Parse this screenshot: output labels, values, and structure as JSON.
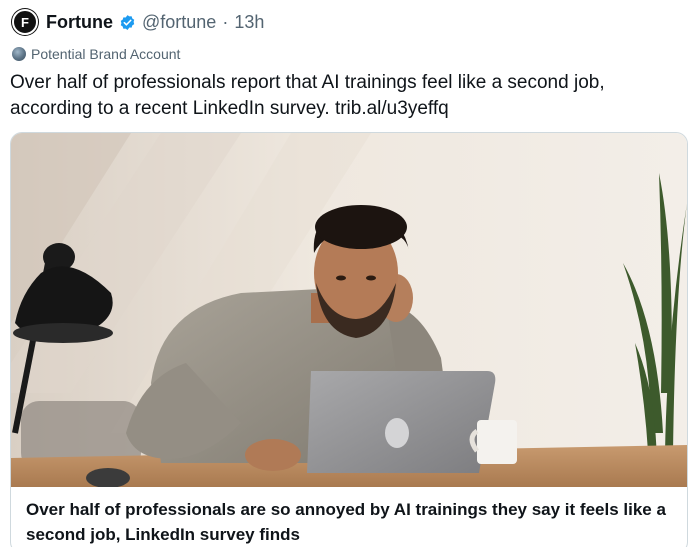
{
  "author": {
    "name": "Fortune",
    "avatar_letter": "F",
    "handle": "@fortune",
    "separator": "·",
    "time": "13h",
    "verified_color": "#1d9bf0"
  },
  "badge": {
    "label": "Potential Brand Account"
  },
  "post": {
    "text": "Over half of professionals report that AI trainings feel like a second job, according to a recent LinkedIn survey. trib.al/u3yeffq"
  },
  "card": {
    "image_description_icon": "photo",
    "title": "Over half of professionals are so annoyed by AI trainings they say it feels like a second job, LinkedIn survey finds"
  }
}
